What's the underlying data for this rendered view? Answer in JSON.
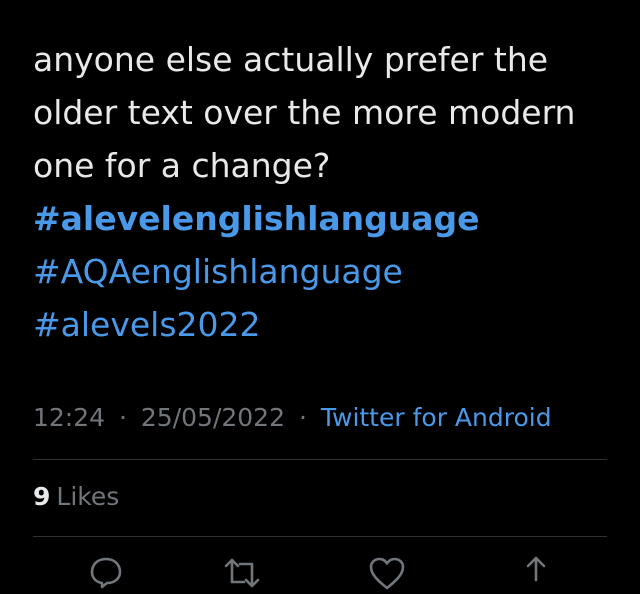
{
  "tweet": {
    "text_lines": [
      "anyone else actually prefer the",
      "older text over the more modern",
      "one for a change?"
    ],
    "hashtags": [
      "#alevelenglishlanguage",
      "#AQAenglishlanguage",
      "#alevels2022"
    ],
    "time": "12:24",
    "date": "25/05/2022",
    "separator": "·",
    "source": "Twitter for Android",
    "likes_count": "9",
    "likes_label": "Likes"
  },
  "actions": {
    "reply_icon": "reply-icon",
    "retweet_icon": "retweet-icon",
    "like_icon": "heart-icon",
    "share_icon": "share-icon"
  },
  "colors": {
    "background": "#000000",
    "text": "#e7e9ea",
    "secondary": "#71767b",
    "link": "#4a99e9",
    "divider": "#2f3336"
  }
}
